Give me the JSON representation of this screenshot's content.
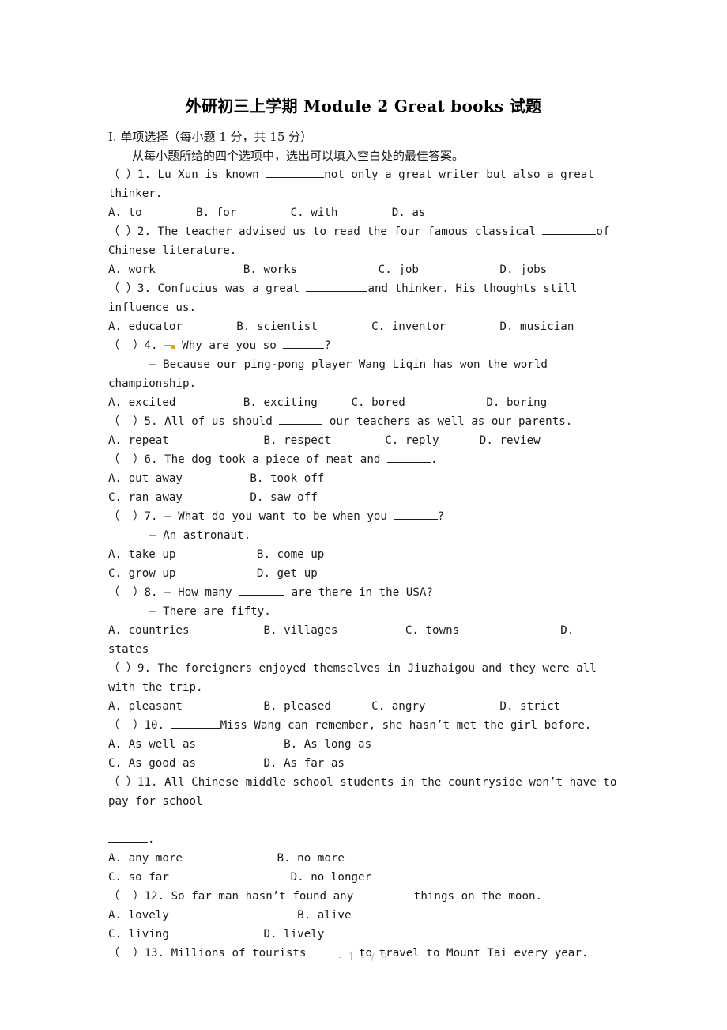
{
  "document": {
    "title": "外研初三上学期 Module 2 Great books 试题",
    "footer": "- 1 - / 9"
  },
  "section": {
    "heading": "I.  单项选择（每小题 1 分，共 15 分）",
    "subheading": "从每小题所给的四个选项中，选出可以填入空白处的最佳答案。"
  },
  "lines": {
    "q1_a": "（    ）1. Lu Xun is known ",
    "q1_b": "not only a great writer but also a great",
    "q1_c": "thinker.",
    "q1_opts": "A. to        B. for        C. with        D. as",
    "q2_a": "（    ）2. The teacher advised us to read the four famous classical ",
    "q2_b": "of",
    "q2_c": "Chinese literature.",
    "q2_opts": "A. work             B. works            C. job            D. jobs",
    "q3_a": "（    ）3. Confucius was a great ",
    "q3_b": "and thinker. His thoughts still",
    "q3_c": "influence us.",
    "q3_opts": "A. educator        B. scientist        C. inventor        D. musician",
    "q4_a": "（  ）4. —",
    "q4_b": " Why are you so ",
    "q4_c": "?",
    "q4_d": "— Because our ping-pong player Wang Liqin has won the world",
    "q4_e": "championship.",
    "q4_opts": "A. excited          B. exciting     C. bored            D. boring",
    "q5_a": "（  ）5. All of us should ",
    "q5_b": " our teachers as well as our parents.",
    "q5_opts": "A. repeat              B. respect        C. reply      D. review",
    "q6_a": "（  ）6. The dog took a piece of meat and ",
    "q6_b": ".",
    "q6_opt_ab": "A. put away          B. took off",
    "q6_opt_cd": "C. ran away          D. saw off",
    "q7_a": "（  ）7. — What do you want to be when you ",
    "q7_b": "?",
    "q7_c": "— An astronaut.",
    "q7_opt_ab": "A. take up            B. come up",
    "q7_opt_cd": "C. grow up            D. get up",
    "q8_a": "（  ）8. — How many ",
    "q8_b": " are there in the USA?",
    "q8_c": "— There are fifty.",
    "q8_opts": "A. countries           B. villages          C. towns               D. states",
    "q9_a": "（    ）9. The foreigners enjoyed themselves in Jiuzhaigou and they were all",
    "q9_b": "with the trip.",
    "q9_opts": "A. pleasant            B. pleased      C. angry           D. strict",
    "q10_a": "（  ）10. ",
    "q10_b": "Miss Wang can remember, she hasn’t met the girl before.",
    "q10_opt_ab": "A. As well as             B. As long as",
    "q10_opt_cd": "C. As good as          D. As far as",
    "q11_a": "（  ）11. All Chinese middle school students in the countryside won’t have to",
    "q11_b": "pay for school",
    "q11_c": ".",
    "q11_opt_ab": "A. any more              B. no more",
    "q11_opt_cd": "C. so far                  D. no longer",
    "q12_a": "（  ）12. So far man hasn’t found any ",
    "q12_b": "things on the moon.",
    "q12_opt_ab": "A. lovely                   B. alive",
    "q12_opt_cd": "C. living              D. lively",
    "q13_a": "（  ）13. Millions of tourists ",
    "q13_b": "to travel to Mount Tai every year."
  }
}
